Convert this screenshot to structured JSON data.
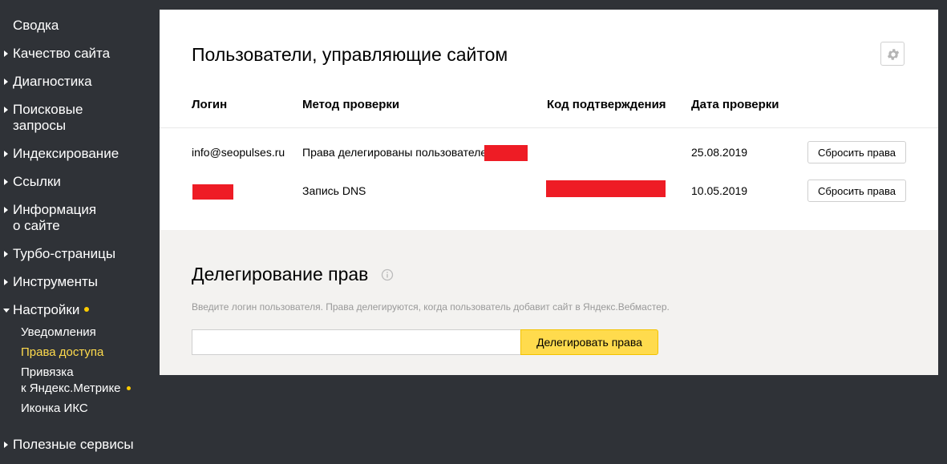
{
  "sidebar": {
    "items": [
      {
        "label": "Сводка"
      },
      {
        "label": "Качество сайта"
      },
      {
        "label": "Диагностика"
      },
      {
        "label": "Поисковые"
      },
      {
        "label": "запросы"
      },
      {
        "label": "Индексирование"
      },
      {
        "label": "Ссылки"
      },
      {
        "label": "Информация"
      },
      {
        "label": "о сайте"
      },
      {
        "label": "Турбо-страницы"
      },
      {
        "label": "Инструменты"
      },
      {
        "label": "Настройки"
      },
      {
        "label": "Полезные сервисы"
      }
    ],
    "subitems": [
      {
        "label": "Уведомления"
      },
      {
        "label": "Права доступа"
      },
      {
        "label": "Привязка"
      },
      {
        "label": "к Яндекс.Метрике"
      },
      {
        "label": "Иконка ИКС"
      }
    ],
    "accent": "#ffcc00"
  },
  "users": {
    "title": "Пользователи, управляющие сайтом",
    "columns": [
      "Логин",
      "Метод проверки",
      "Код подтверждения",
      "Дата проверки"
    ],
    "rows": [
      {
        "login": "info@seopulses.ru",
        "method": "Права делегированы пользователем",
        "date": "25.08.2019",
        "action": "Сбросить права"
      },
      {
        "login": "",
        "method": "Запись DNS",
        "date": "10.05.2019",
        "action": "Сбросить права"
      }
    ],
    "icons": {
      "settings": "gear-icon"
    }
  },
  "delegation": {
    "title": "Делегирование прав",
    "hint": "Введите логин пользователя. Права делегируются, когда пользователь добавит сайт в Яндекс.Вебмастер.",
    "input_value": "",
    "button": "Делегировать права",
    "button_color": "#ffdb4d",
    "icons": {
      "info": "info-icon"
    }
  }
}
